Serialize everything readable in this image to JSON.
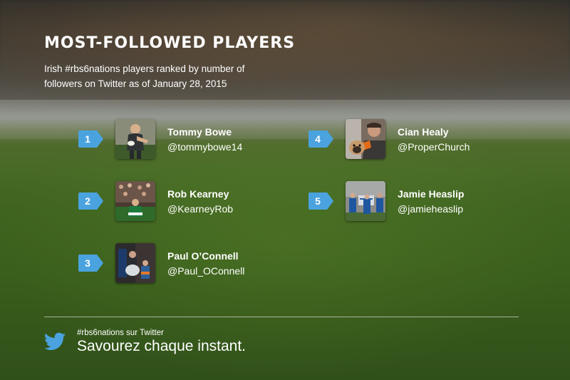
{
  "header": {
    "title": "MOST-FOLLOWED PLAYERS",
    "subtitle": "Irish #rbs6nations players ranked by number of followers on Twitter as of January 28, 2015"
  },
  "players": [
    {
      "rank": "1",
      "name": "Tommy Bowe",
      "handle": "@tommybowe14"
    },
    {
      "rank": "2",
      "name": "Rob Kearney",
      "handle": "@KearneyRob"
    },
    {
      "rank": "3",
      "name": "Paul O’Connell",
      "handle": "@Paul_OConnell"
    },
    {
      "rank": "4",
      "name": "Cian Healy",
      "handle": "@ProperChurch"
    },
    {
      "rank": "5",
      "name": "Jamie Heaslip",
      "handle": "@jamieheaslip"
    }
  ],
  "footer": {
    "icon": "twitter-bird-icon",
    "tag": "#rbs6nations sur Twitter",
    "slogan": "Savourez chaque instant."
  },
  "colors": {
    "rank_badge": "#4aa3df",
    "twitter_blue": "#4aa3df",
    "text": "#ffffff"
  }
}
